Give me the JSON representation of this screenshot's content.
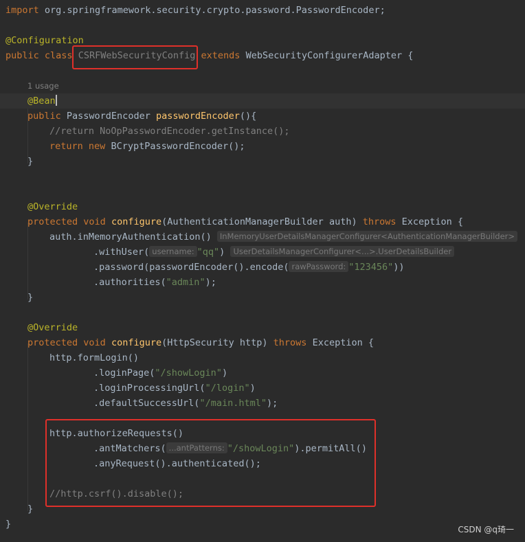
{
  "lines": {
    "l1": {
      "kw": "import",
      "rest": " org.springframework.security.crypto.password.PasswordEncoder;"
    },
    "l2": {
      "ann": "@Configuration"
    },
    "l3": {
      "kw1": "public",
      "kw2": "class",
      "classname": "CSRFWebSecurityConfig",
      "kw3": "extends",
      "rest": " WebSecurityConfigurerAdapter {"
    },
    "l4": {
      "usage": "1 usage"
    },
    "l5": {
      "ann": "@Bean"
    },
    "l6": {
      "kw": "public",
      "type": " PasswordEncoder ",
      "meth": "passwordEncoder",
      "rest": "(){"
    },
    "l7": {
      "cmt": "//return NoOpPasswordEncoder.getInstance();"
    },
    "l8": {
      "kw1": "return",
      "kw2": "new",
      "rest": " BCryptPasswordEncoder();"
    },
    "l9": {
      "text": "}"
    },
    "l10": {
      "ann": "@Override"
    },
    "l11": {
      "kw1": "protected",
      "kw2": "void",
      "meth": "configure",
      "mid": "(AuthenticationManagerBuilder auth) ",
      "kw3": "throws",
      "rest": " Exception {"
    },
    "l12": {
      "text": "auth.inMemoryAuthentication()",
      "hint": "InMemoryUserDetailsManagerConfigurer<AuthenticationManagerBuilder>"
    },
    "l13": {
      "pre": ".withUser(",
      "hint1": "username:",
      "str": "\"qq\"",
      "post": ")",
      "hint2": "UserDetailsManagerConfigurer<...>.UserDetailsBuilder"
    },
    "l14": {
      "pre": ".password(passwordEncoder().encode(",
      "hint": "rawPassword:",
      "str": "\"123456\"",
      "post": "))"
    },
    "l15": {
      "pre": ".authorities(",
      "str": "\"admin\"",
      "post": ");"
    },
    "l16": {
      "text": "}"
    },
    "l17": {
      "ann": "@Override"
    },
    "l18": {
      "kw1": "protected",
      "kw2": "void",
      "meth": "configure",
      "mid": "(HttpSecurity http) ",
      "kw3": "throws",
      "rest": " Exception {"
    },
    "l19": {
      "text": "http.formLogin()"
    },
    "l20": {
      "pre": ".loginPage(",
      "str": "\"/showLogin\"",
      "post": ")"
    },
    "l21": {
      "pre": ".loginProcessingUrl(",
      "str": "\"/login\"",
      "post": ")"
    },
    "l22": {
      "pre": ".defaultSuccessUrl(",
      "str": "\"/main.html\"",
      "post": ");"
    },
    "l23": {
      "text": "http.authorizeRequests()"
    },
    "l24": {
      "pre": ".antMatchers(",
      "hint": "...antPatterns:",
      "str": "\"/showLogin\"",
      "post": ").permitAll()"
    },
    "l25": {
      "text": ".anyRequest().authenticated();"
    },
    "l26": {
      "cmt": "//http.csrf().disable();"
    },
    "l27": {
      "text": "}"
    },
    "l28": {
      "text": "}"
    }
  },
  "watermark": "CSDN @q琦一",
  "colors": {
    "highlight_box": "#e0302a",
    "background": "#2b2b2b",
    "keyword": "#cc7832",
    "string": "#6a8759",
    "method": "#ffc66d",
    "annotation": "#bbb529"
  }
}
